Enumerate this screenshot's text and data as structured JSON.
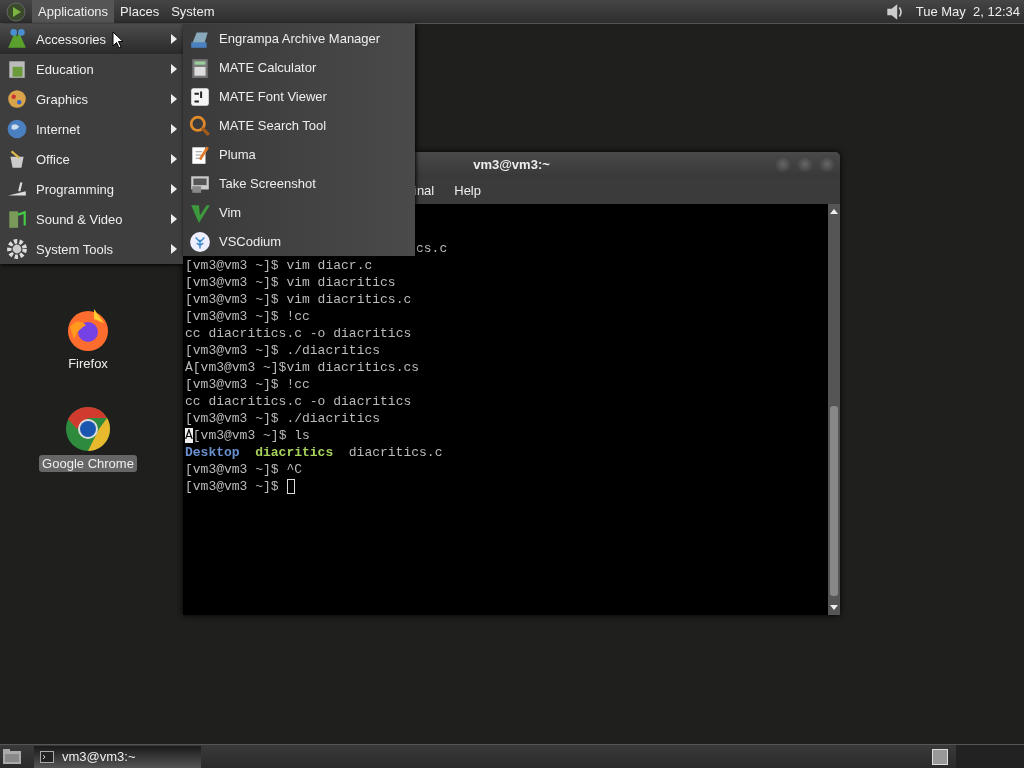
{
  "top_panel": {
    "menus": [
      {
        "label": "Applications",
        "selected": true
      },
      {
        "label": "Places",
        "selected": false
      },
      {
        "label": "System",
        "selected": false
      }
    ],
    "clock": "Tue May  2, 12:34"
  },
  "desktop_icons": [
    {
      "label": "Firefox",
      "selected": false
    },
    {
      "label": "Google Chrome",
      "selected": true
    }
  ],
  "terminal": {
    "title": "vm3@vm3:~",
    "menus": [
      "inal",
      "Help"
    ],
    "lines": [
      [
        {
          "kind": "plain",
          "text": "cs.c"
        }
      ],
      [
        {
          "kind": "plain",
          "text": "[vm3@vm3 ~]$ vim diacr.c"
        }
      ],
      [
        {
          "kind": "plain",
          "text": "[vm3@vm3 ~]$ vim diacritics"
        }
      ],
      [
        {
          "kind": "plain",
          "text": "[vm3@vm3 ~]$ vim diacritics.c"
        }
      ],
      [
        {
          "kind": "plain",
          "text": "[vm3@vm3 ~]$ !cc"
        }
      ],
      [
        {
          "kind": "plain",
          "text": "cc diacritics.c -o diacritics"
        }
      ],
      [
        {
          "kind": "plain",
          "text": "[vm3@vm3 ~]$ ./diacritics"
        }
      ],
      [
        {
          "kind": "plain",
          "text": "Ȧ[vm3@vm3 ~]$vim diacritics.cs"
        }
      ],
      [
        {
          "kind": "plain",
          "text": "[vm3@vm3 ~]$ !cc"
        }
      ],
      [
        {
          "kind": "plain",
          "text": "cc diacritics.c -o diacritics"
        }
      ],
      [
        {
          "kind": "plain",
          "text": "[vm3@vm3 ~]$ ./diacritics"
        }
      ],
      [
        {
          "kind": "inverse",
          "text": "Ȧ"
        },
        {
          "kind": "plain",
          "text": "[vm3@vm3 ~]$ ls"
        }
      ],
      [
        {
          "kind": "dir",
          "text": "Desktop"
        },
        {
          "kind": "exec",
          "text": "diacritics"
        },
        {
          "kind": "plain",
          "text": "diacritics.c"
        }
      ],
      [
        {
          "kind": "plain",
          "text": "[vm3@vm3 ~]$ ^C"
        }
      ],
      [
        {
          "kind": "plain",
          "text": "[vm3@vm3 ~]$"
        }
      ]
    ]
  },
  "applications_menu": [
    {
      "label": "Accessories",
      "selected": true
    },
    {
      "label": "Education",
      "selected": false
    },
    {
      "label": "Graphics",
      "selected": false
    },
    {
      "label": "Internet",
      "selected": false
    },
    {
      "label": "Office",
      "selected": false
    },
    {
      "label": "Programming",
      "selected": false
    },
    {
      "label": "Sound & Video",
      "selected": false
    },
    {
      "label": "System Tools",
      "selected": false
    }
  ],
  "accessories_submenu": [
    "Engrampa Archive Manager",
    "MATE Calculator",
    "MATE Font Viewer",
    "MATE Search Tool",
    "Pluma",
    "Take Screenshot",
    "Vim",
    "VSCodium"
  ],
  "taskbar": {
    "tasks": [
      {
        "label": "vm3@vm3:~",
        "selected": false
      }
    ]
  }
}
